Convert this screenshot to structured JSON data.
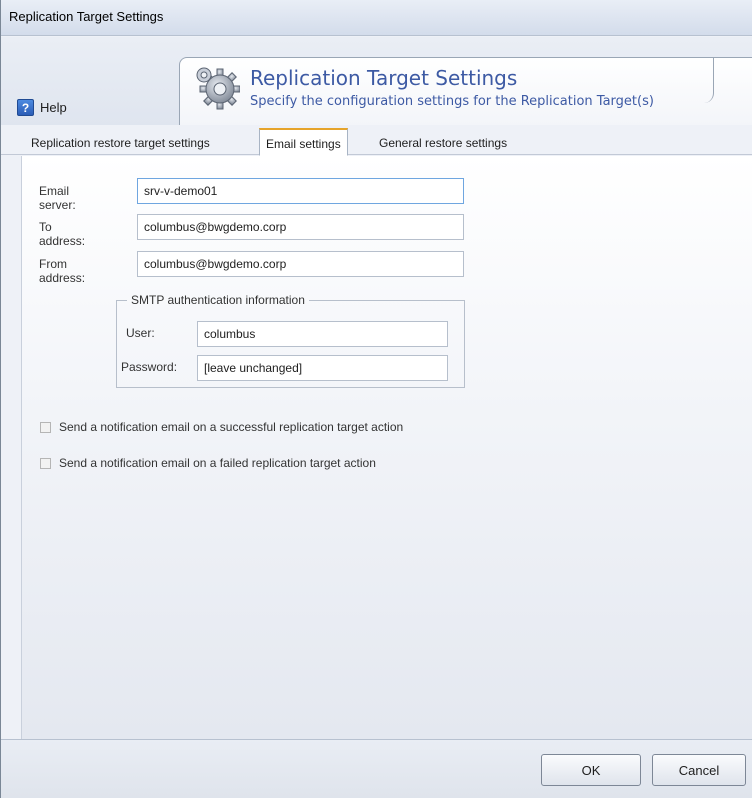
{
  "window": {
    "title": "Replication Target Settings"
  },
  "header": {
    "title": "Replication Target Settings",
    "subtitle": "Specify the configuration settings for the Replication Target(s)",
    "help_label": "Help",
    "help_icon": "?"
  },
  "tabs": [
    {
      "label": "Replication restore target settings",
      "active": false
    },
    {
      "label": "Email settings",
      "active": true
    },
    {
      "label": "General restore settings",
      "active": false
    }
  ],
  "email": {
    "server_label": "Email server:",
    "server_value": "srv-v-demo01",
    "to_label": "To address:",
    "to_value": "columbus@bwgdemo.corp",
    "from_label": "From address:",
    "from_value": "columbus@bwgdemo.corp"
  },
  "smtp": {
    "legend": "SMTP authentication information",
    "user_label": "User:",
    "user_value": "columbus",
    "password_label": "Password:",
    "password_value": "[leave unchanged]"
  },
  "notifications": {
    "success_label": "Send a notification email on a successful replication target action",
    "success_checked": false,
    "failure_label": "Send a notification email on a failed replication target action",
    "failure_checked": false
  },
  "footer": {
    "ok_label": "OK",
    "cancel_label": "Cancel"
  },
  "colors": {
    "accent": "#3d5aa4",
    "active_tab_border": "#e6a42a"
  }
}
